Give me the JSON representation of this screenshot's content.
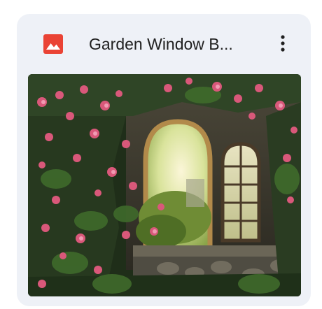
{
  "file": {
    "title": "Garden Window B...",
    "type_icon": "image-file-icon",
    "more_icon": "more-vert-icon"
  },
  "colors": {
    "card_background": "#eef1f7",
    "image_icon_red": "#ea4335",
    "title_text": "#1f1f1f"
  }
}
